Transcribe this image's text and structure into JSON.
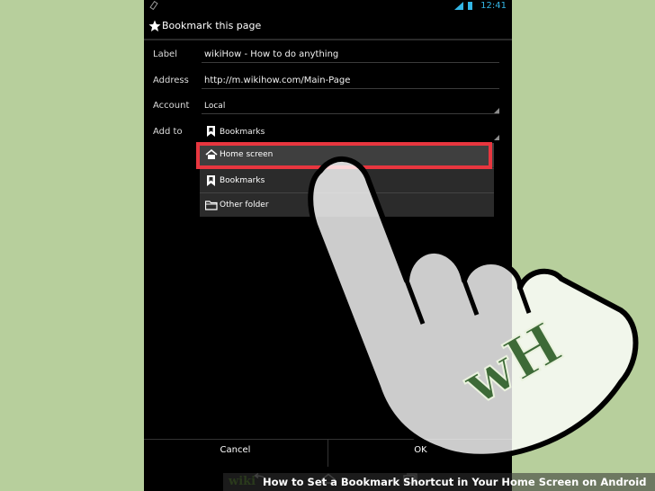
{
  "status_bar": {
    "time": "12:41"
  },
  "dialog": {
    "title": "Bookmark this page",
    "fields": {
      "label": {
        "name": "Label",
        "value": "wikiHow - How to do anything"
      },
      "address": {
        "name": "Address",
        "value": "http://m.wikihow.com/Main-Page"
      },
      "account": {
        "name": "Account",
        "value": "Local"
      },
      "add_to": {
        "name": "Add to",
        "value": "Bookmarks"
      }
    },
    "dropdown": {
      "items": [
        {
          "label": "Home screen",
          "icon": "home-icon"
        },
        {
          "label": "Bookmarks",
          "icon": "bookmark-icon"
        },
        {
          "label": "Other folder",
          "icon": "folder-icon"
        }
      ]
    },
    "buttons": {
      "cancel": "Cancel",
      "ok": "OK"
    }
  },
  "overlay": {
    "watermark": "wH"
  },
  "caption": {
    "brand": "wiki",
    "text": "How to Set a Bookmark Shortcut in Your Home Screen on Android"
  },
  "colors": {
    "background": "#b7cf9c",
    "highlight": "#e8363f",
    "status_accent": "#33b5e5",
    "watermark": "#3d6a37"
  }
}
